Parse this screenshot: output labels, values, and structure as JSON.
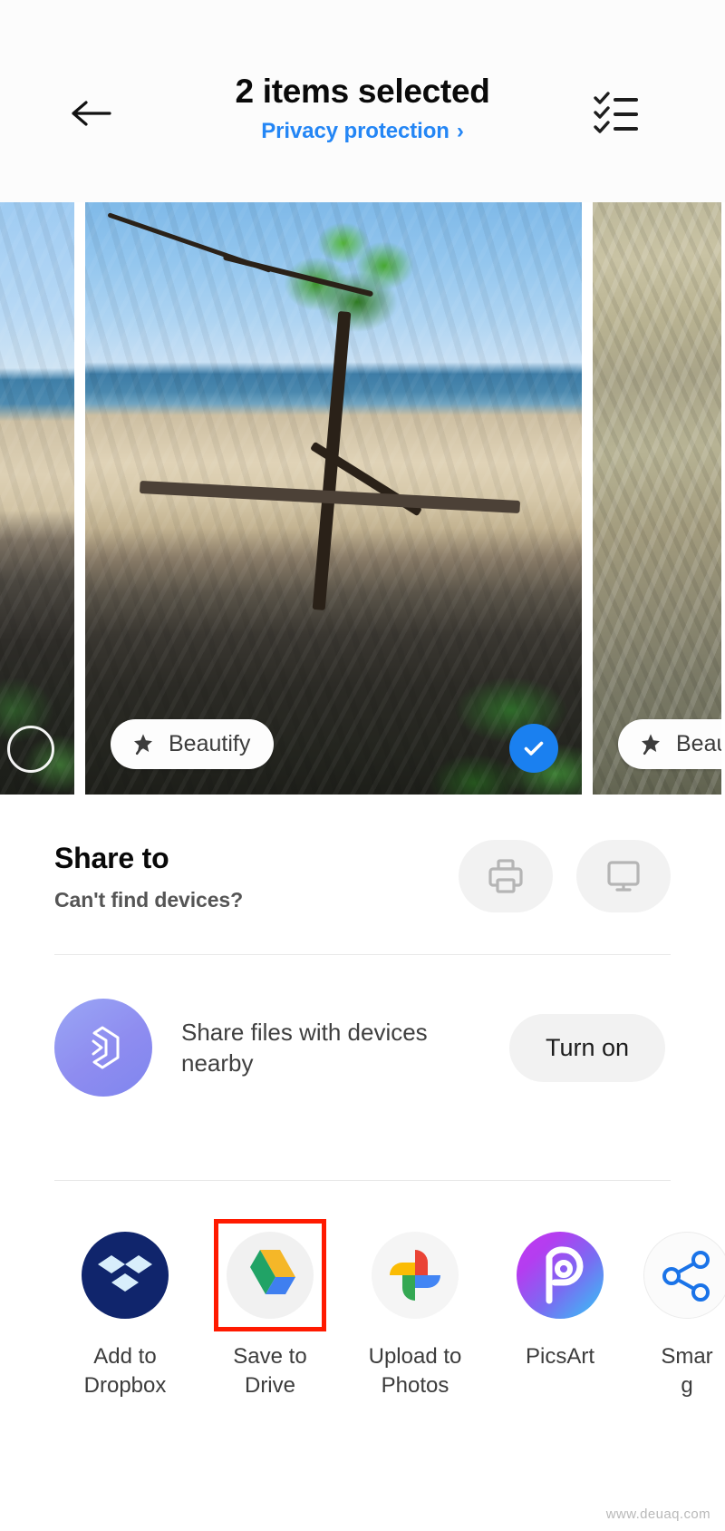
{
  "header": {
    "back_icon": "arrow-left-icon",
    "title": "2 items selected",
    "privacy_label": "Privacy protection",
    "privacy_chevron": "›",
    "checklist_icon": "checklist-icon",
    "link_color": "#2486f5"
  },
  "photos": {
    "items": [
      {
        "name": "photo-left-partial",
        "selected": false,
        "chip_label": ""
      },
      {
        "name": "photo-main-beach-tree",
        "selected": true,
        "chip_label": "Beautify"
      },
      {
        "name": "photo-right-partial",
        "selected": false,
        "chip_label": "Beautify"
      }
    ],
    "beautify_icon": "magic-wand-icon",
    "check_icon": "check-icon",
    "selected_color": "#1a80f0"
  },
  "share": {
    "title": "Share to",
    "subtitle": "Can't find devices?",
    "actions": [
      {
        "name": "print-button",
        "icon": "printer-icon"
      },
      {
        "name": "cast-button",
        "icon": "monitor-icon"
      }
    ]
  },
  "nearby": {
    "icon": "quick-share-icon",
    "text": "Share files with devices nearby",
    "button_label": "Turn on",
    "gradient_from": "#9aa6f5",
    "gradient_to": "#7f86ee"
  },
  "apps": [
    {
      "name": "app-dropbox",
      "label": "Add to\nDropbox",
      "icon": "dropbox-icon",
      "highlighted": false
    },
    {
      "name": "app-drive",
      "label": "Save to\nDrive",
      "icon": "google-drive-icon",
      "highlighted": true
    },
    {
      "name": "app-photos",
      "label": "Upload to\nPhotos",
      "icon": "google-photos-icon",
      "highlighted": false
    },
    {
      "name": "app-picsart",
      "label": "PicsArt",
      "icon": "picsart-icon",
      "highlighted": false
    },
    {
      "name": "app-smart",
      "label": "Smar\ng",
      "icon": "smart-share-icon",
      "highlighted": false
    }
  ],
  "highlight_color": "#ff1a00",
  "watermark": "www.deuaq.com"
}
